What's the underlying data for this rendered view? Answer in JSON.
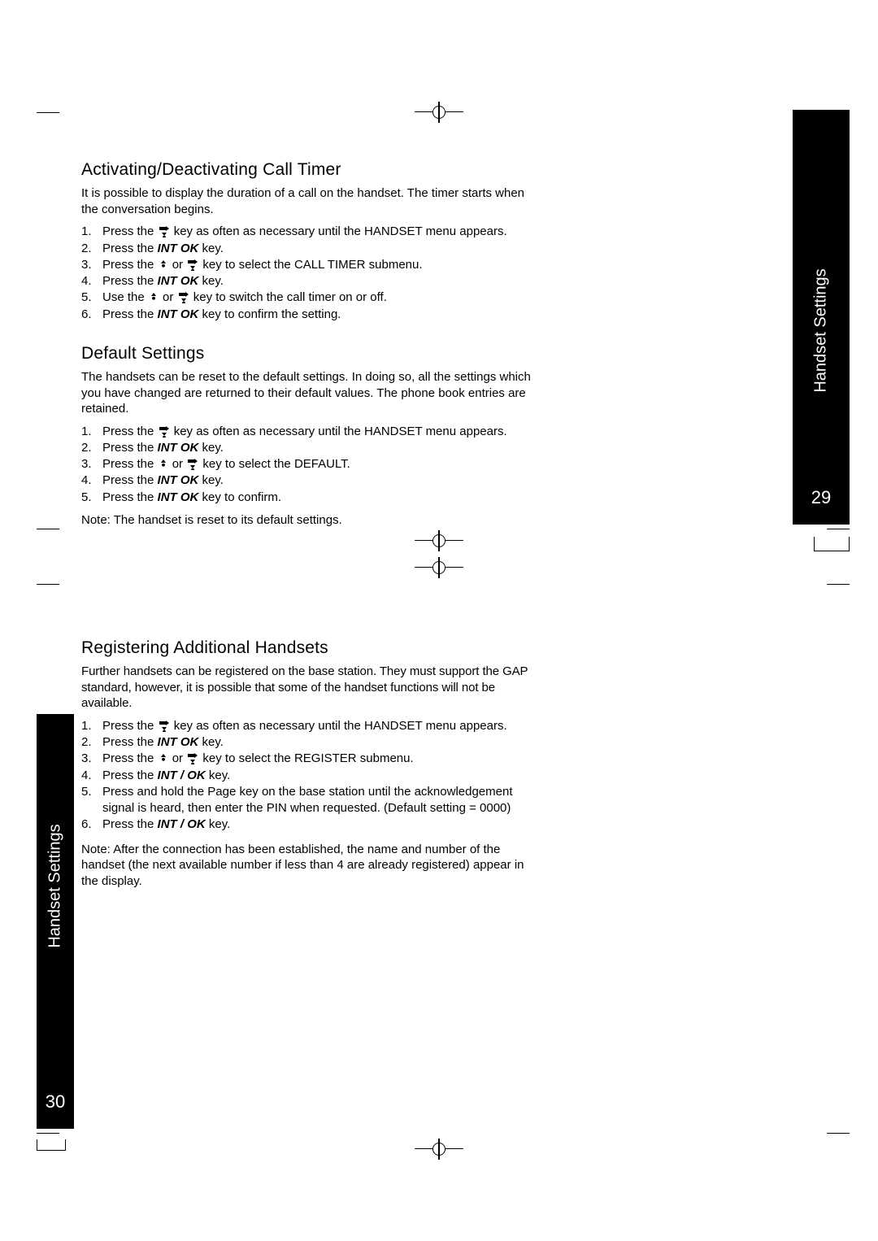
{
  "page29": {
    "side_label": "Handset Settings",
    "page_number": "29",
    "section1": {
      "heading": "Activating/Deactivating Call Timer",
      "intro": "It is possible to display the duration of a call on the handset. The timer starts when the conversation begins.",
      "steps": [
        {
          "n": "1.",
          "pre": "Press the ",
          "icon": "down",
          "post": " key as often as necessary until the HANDSET menu appears."
        },
        {
          "n": "2.",
          "pre": "Press the ",
          "key": "INT  OK",
          "post": " key."
        },
        {
          "n": "3.",
          "pre": "Press the ",
          "icon": "up",
          "mid": " or ",
          "icon2": "down",
          "post": " key to select the CALL TIMER submenu."
        },
        {
          "n": "4.",
          "pre": "Press the ",
          "key": "INT  OK",
          "post": " key."
        },
        {
          "n": "5.",
          "pre": "Use the ",
          "icon": "up",
          "mid": " or ",
          "icon2": "down",
          "post": " key to switch the call timer on or off."
        },
        {
          "n": "6.",
          "pre": "Press the ",
          "key": "INT  OK",
          "post": " key to confirm the setting."
        }
      ]
    },
    "section2": {
      "heading": "Default Settings",
      "intro": "The handsets can be reset to the default settings. In doing so, all the settings which you have changed are returned to their default values. The phone book entries are retained.",
      "steps": [
        {
          "n": "1.",
          "pre": "Press the ",
          "icon": "down",
          "post": " key as often as necessary until the HANDSET menu appears."
        },
        {
          "n": "2.",
          "pre": "Press the ",
          "key": "INT  OK",
          "post": " key."
        },
        {
          "n": "3.",
          "pre": "Press the ",
          "icon": "up",
          "mid": " or ",
          "icon2": "down",
          "post": " key to select the DEFAULT."
        },
        {
          "n": "4.",
          "pre": "Press the ",
          "key": "INT  OK",
          "post": " key."
        },
        {
          "n": "5.",
          "pre": "Press the ",
          "key": "INT  OK",
          "post": " key to confirm."
        }
      ],
      "note": "Note: The handset is reset to its default settings."
    }
  },
  "page30": {
    "side_label": "Handset Settings",
    "page_number": "30",
    "section1": {
      "heading": "Registering Additional Handsets",
      "intro": "Further handsets can be registered on the base station. They must support the GAP standard, however, it is possible that some of the handset functions will not be available.",
      "steps": [
        {
          "n": "1.",
          "pre": "Press the ",
          "icon": "down",
          "post": " key as often as necessary until the HANDSET menu appears."
        },
        {
          "n": "2.",
          "pre": "Press the ",
          "key": "INT  OK",
          "post": " key."
        },
        {
          "n": "3.",
          "pre": "Press the ",
          "icon": "up",
          "mid": " or ",
          "icon2": "down",
          "post": " key to select the REGISTER submenu."
        },
        {
          "n": "4.",
          "pre": "Press the ",
          "key": "INT / OK",
          "post": " key."
        },
        {
          "n": "5.",
          "pre": "Press and hold the Page key on the base station until the acknowledgement signal is heard, then enter the PIN when requested. (Default setting = 0000)",
          "plain": true
        },
        {
          "n": "6.",
          "pre": "Press the ",
          "key": "INT / OK",
          "post": "  key."
        }
      ],
      "note": "Note: After the connection has been established, the name and number of the handset (the next available number if less than 4 are already registered) appear in the display."
    }
  }
}
